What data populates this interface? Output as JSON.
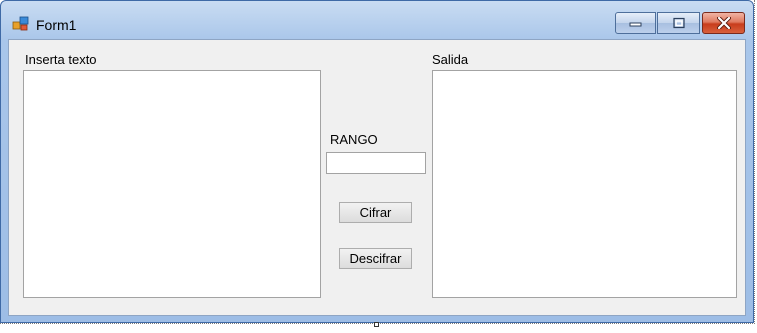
{
  "window": {
    "title": "Form1",
    "app_icon": "winforms-app-icon",
    "caption_buttons": {
      "minimize_icon": "minimize-icon",
      "maximize_icon": "maximize-icon",
      "close_icon": "close-icon"
    }
  },
  "form": {
    "input_label": "Inserta texto",
    "input_value": "",
    "output_label": "Salida",
    "output_value": "",
    "range_label": "RANGO",
    "range_value": "",
    "encrypt_button": "Cifrar",
    "decrypt_button": "Descifrar"
  },
  "colors": {
    "title_bar": "#b9d1ee",
    "client_background": "#f0f0f0",
    "close_button": "#c83c1c"
  }
}
